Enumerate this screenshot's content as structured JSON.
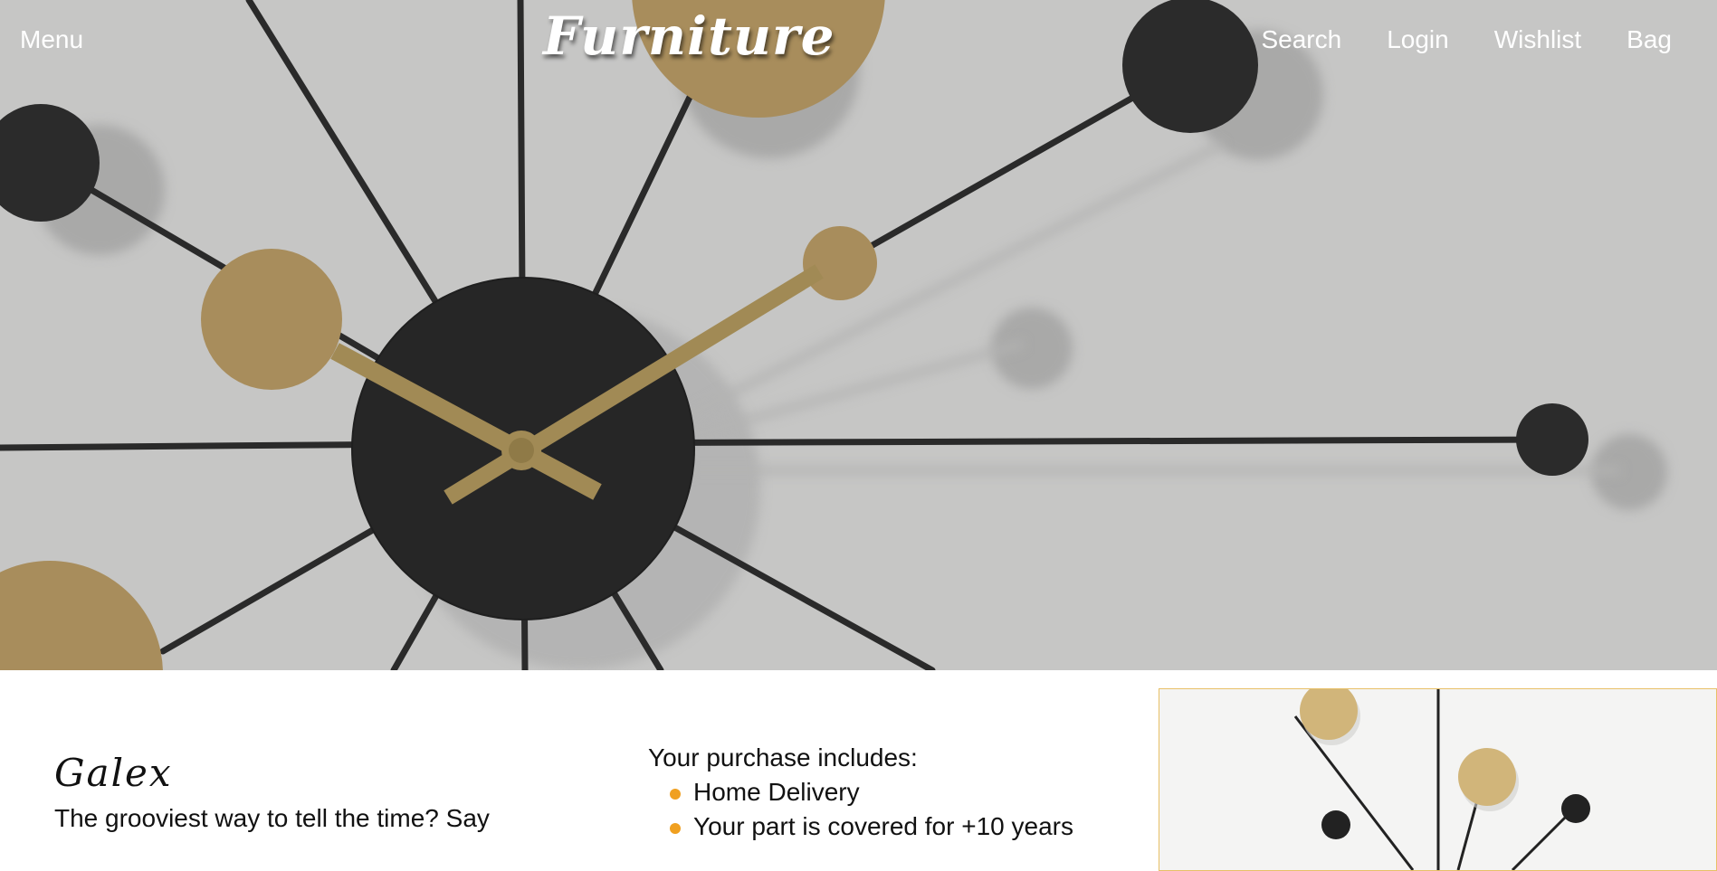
{
  "header": {
    "menu_label": "Menu",
    "logo_text": "Furniture",
    "nav": {
      "search": "Search",
      "login": "Login",
      "wishlist": "Wishlist",
      "bag": "Bag"
    }
  },
  "product": {
    "name": "Galex",
    "description": "The grooviest way to tell the time? Say"
  },
  "purchase": {
    "heading": "Your purchase includes:",
    "items": [
      "Home Delivery",
      "Your part is covered for +10 years"
    ]
  },
  "colors": {
    "accent": "#f0a020",
    "thumb_border": "#e8c067",
    "hero_background": "#c6c6c5"
  }
}
